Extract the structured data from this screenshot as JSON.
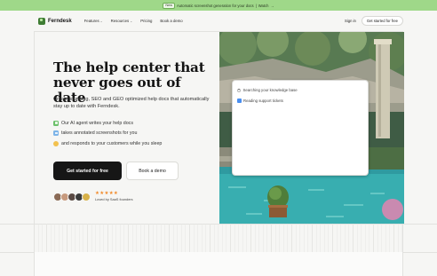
{
  "announcement": {
    "badge": "New",
    "text": "Automatic screenshot generation for your docs",
    "separator": "|",
    "link": "Watch",
    "link_arrow": "→"
  },
  "nav": {
    "brand": "Ferndesk",
    "features": "Features",
    "resources": "Resources",
    "pricing": "Pricing",
    "demo": "Book a demo",
    "sign_in": "Sign in",
    "get_started": "Get started for free"
  },
  "hero": {
    "headline": "The help center that never goes out of date",
    "subheadline": "Create stunning, SEO and GEO optimized help docs that automatically stay up to date with Ferndesk.",
    "features": [
      {
        "icon": "ai-agent-icon",
        "text": "Our AI agent writes your help docs"
      },
      {
        "icon": "screenshot-icon",
        "text": "takes annotated screenshots for you"
      },
      {
        "icon": "smiley-icon",
        "text": "and responds to your customers while you sleep"
      }
    ],
    "cta_primary": "Get started for free",
    "cta_secondary": "Book a demo",
    "stars": "★★★★★",
    "loved_by": "Loved by SaaS founders"
  },
  "card": {
    "searching": "Searching your knowledge base",
    "reading": "Reading support tickets"
  },
  "colors": {
    "announce_bg": "#9fd889",
    "brand_green": "#3f7d34",
    "dark_button": "#161616",
    "star": "#f28b2b"
  }
}
